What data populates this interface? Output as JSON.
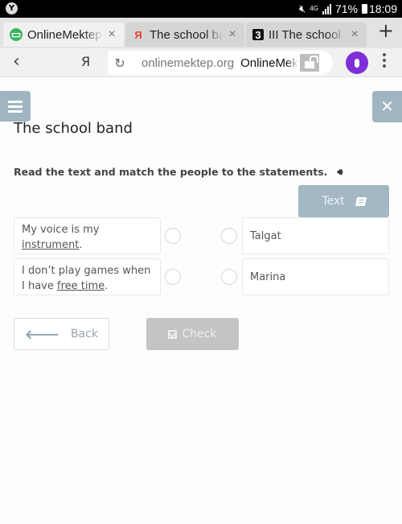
{
  "status_bar": {
    "left_icon": "yandex-browser-notification-icon",
    "network": "4G",
    "battery": "71%",
    "time": "18:09"
  },
  "tabs": [
    {
      "title": "OnlineMektep",
      "favicon": "onlinemektep-favicon",
      "active": true
    },
    {
      "title": "The school band",
      "favicon": "yandex-favicon",
      "active": false
    },
    {
      "title": "III The school",
      "favicon": "tab-3-favicon",
      "active": false
    }
  ],
  "tabstrip": {
    "new_tab": "+",
    "close": "×"
  },
  "addressbar": {
    "back": "‹",
    "yandex": "Я",
    "reload": "↻",
    "url": "onlinemektep.org",
    "site_name": "OnlineMektep"
  },
  "page": {
    "title": "The school band",
    "instruction": "Read the text and match the people to the statements.",
    "text_button": "Text",
    "statements": [
      {
        "before": "My voice is my ",
        "underlined": "instrument",
        "after": "."
      },
      {
        "before": "I don’t play games when I have ",
        "underlined": "free time",
        "after": "."
      }
    ],
    "people": [
      "Talgat",
      "Marina"
    ],
    "back_button": "Back",
    "check_button": "Check",
    "colors": {
      "header_button": "#9fb5c1",
      "text_button": "#a3b8c3",
      "check_disabled": "#c4c4c4",
      "mic": "#7e2fd8"
    }
  }
}
